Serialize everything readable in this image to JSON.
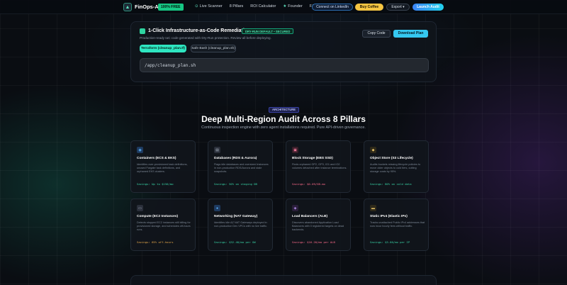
{
  "nav": {
    "logo_icon": "chart-icon",
    "logo_text": "FinOps-AI",
    "logo_badge": "100% FREE",
    "links": [
      {
        "label": "Live Scanner",
        "icon": "scan-icon"
      },
      {
        "label": "8 Pillars",
        "icon": ""
      },
      {
        "label": "ROI Calculator",
        "icon": ""
      },
      {
        "label": "Founder",
        "icon": "star-icon"
      },
      {
        "label": "FAQ",
        "icon": ""
      }
    ],
    "linkedin_label": "Connect on LinkedIn",
    "coffee_label": "Buy Coffee",
    "export_label": "Export ▾",
    "launch_label": "Launch Audit"
  },
  "remediation": {
    "title": "1-Click Infrastructure-as-Code Remediation",
    "badge": "DRY-RUN DEFAULT • SECURED",
    "subtitle": "Production-ready IaC code generated with Dry-Run protection. Review all before deploying.",
    "copy_label": "Copy Code",
    "download_label": "Download Plan",
    "tabs": [
      "Terraform (cleanup_plan.tf)",
      "Safe Bash (cleanup_plan.sh)"
    ],
    "code": "/app/cleanup_plan.sh"
  },
  "architecture": {
    "badge": "ARCHITECTURE",
    "title": "Deep Multi-Region Audit Across 8 Pillars",
    "subtitle": "Continuous inspection engine with zero agent installations required. Pure API-driven governance.",
    "cards": [
      {
        "icon": "container-icon",
        "icon_color": "#1e3a5f",
        "glyph": "◉",
        "glyph_color": "#5fb7ff",
        "title": "Containers (ECS & EKS)",
        "desc": "Identifies over-provisioned task definitions, unused Fargate task definitions, and orphaned EKS clusters.",
        "savings": "Savings: Up to $150/mo",
        "savings_color": "#39d6a8"
      },
      {
        "icon": "database-icon",
        "icon_color": "#2a2f3a",
        "glyph": "▤",
        "glyph_color": "#aab4c2",
        "title": "Databases (RDS & Aurora)",
        "desc": "Flags idle databases and oversized instances in non-production RDS/Aurora and stale snapshots.",
        "savings": "Savings: 50% on staging DB",
        "savings_color": "#39d6a8"
      },
      {
        "icon": "disk-icon",
        "icon_color": "#3a1f2a",
        "glyph": "▣",
        "glyph_color": "#ff7fa3",
        "title": "Block Storage (EBS SSD)",
        "desc": "Finds orphaned GP2, GP3, IO1 and IO2 volumes detached after instance terminations.",
        "savings": "Savings: $0.09/GB-mo",
        "savings_color": "#ff6b8b"
      },
      {
        "icon": "bucket-icon",
        "icon_color": "#2f2a1a",
        "glyph": "◆",
        "glyph_color": "#e8c46a",
        "title": "Object Store (S3 Lifecycle)",
        "desc": "Audits buckets missing lifecycle policies to move older objects to cold tiers, cutting storage costs by 95%.",
        "savings": "Savings: 80% on cold data",
        "savings_color": "#39d6a8"
      },
      {
        "icon": "server-icon",
        "icon_color": "#2a2f3a",
        "glyph": "▭",
        "glyph_color": "#aab4c2",
        "title": "Compute (EC2 Instances)",
        "desc": "Detects stopped EC2 instances still billing for provisioned storage, and schedules off-hours runs.",
        "savings": "Savings: 65% off-hours",
        "savings_color": "#e8a94a"
      },
      {
        "icon": "network-icon",
        "icon_color": "#1e3a5f",
        "glyph": "●",
        "glyph_color": "#5fb7ff",
        "title": "Networking (NAT Gateway)",
        "desc": "Identifies idle AZ NAT Gateways deployed in non-production Dev VPCs with no live traffic.",
        "savings": "Savings: $32.40/mo per GW",
        "savings_color": "#39d6a8"
      },
      {
        "icon": "balancer-icon",
        "icon_color": "#2a1f3a",
        "glyph": "◈",
        "glyph_color": "#c49bff",
        "title": "Load Balancers (ALB)",
        "desc": "Discovers abandoned Application Load Balancers with 0 registered targets on dead backends.",
        "savings": "Savings: $16.20/mo per ALB",
        "savings_color": "#ff6b8b"
      },
      {
        "icon": "ip-icon",
        "icon_color": "#2f2a1a",
        "glyph": "▬",
        "glyph_color": "#e8c46a",
        "title": "Static IPv4 (Elastic IPs)",
        "desc": "Tracks unattached Public IPv4 addresses that now incur hourly fees without traffic.",
        "savings": "Savings: $3.60/mo per IP",
        "savings_color": "#39d6a8"
      }
    ]
  }
}
